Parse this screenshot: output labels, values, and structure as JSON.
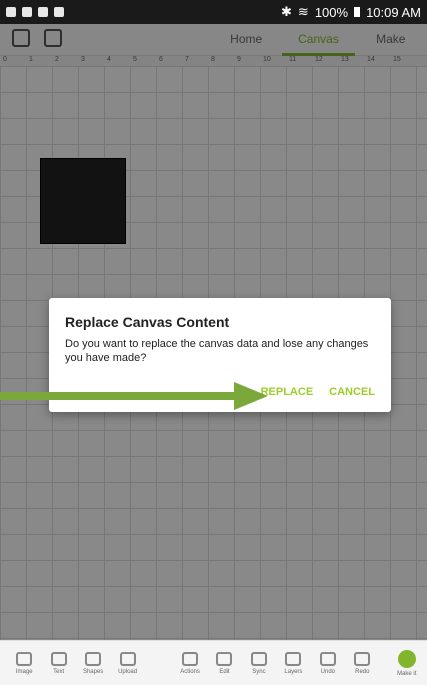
{
  "status_bar": {
    "battery": "100%",
    "time": "10:09 AM"
  },
  "tabs": [
    {
      "label": "Home"
    },
    {
      "label": "Canvas",
      "active": true
    },
    {
      "label": "Make"
    }
  ],
  "ruler": {
    "ticks": [
      "0",
      "1",
      "2",
      "3",
      "4",
      "5",
      "6",
      "7",
      "8",
      "9",
      "10",
      "11",
      "12",
      "13",
      "14",
      "15"
    ]
  },
  "dialog": {
    "title": "Replace Canvas Content",
    "message": "Do you want to replace the canvas data and lose any changes you have made?",
    "replace_label": "REPLACE",
    "cancel_label": "CANCEL"
  },
  "toolbar": {
    "items": [
      {
        "label": "Image"
      },
      {
        "label": "Text"
      },
      {
        "label": "Shapes"
      },
      {
        "label": "Upload"
      },
      {
        "label": "Actions"
      },
      {
        "label": "Edit"
      },
      {
        "label": "Sync"
      },
      {
        "label": "Layers"
      },
      {
        "label": "Undo"
      },
      {
        "label": "Redo"
      },
      {
        "label": "Make it"
      }
    ]
  },
  "colors": {
    "accent": "#81b52e",
    "button_text": "#9ccd2a",
    "arrow": "#7aa83a"
  }
}
